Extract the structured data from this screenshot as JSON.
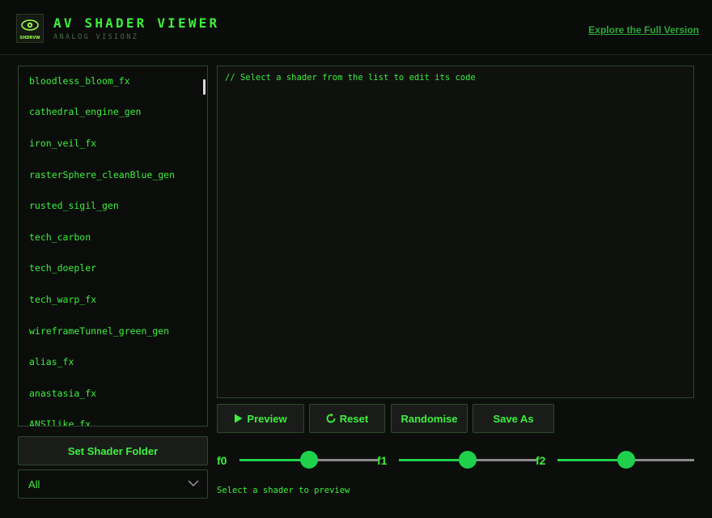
{
  "header": {
    "logo_text": "SHDRVW",
    "title": "AV SHADER VIEWER",
    "subtitle": "ANALOG VISIONZ",
    "explore_link": "Explore the Full Version"
  },
  "shader_list": {
    "items": [
      "bloodless_bloom_fx",
      "cathedral_engine_gen",
      "iron_veil_fx",
      "rasterSphere_cleanBlue_gen",
      "rusted_sigil_gen",
      "tech_carbon",
      "tech_doepler",
      "tech_warp_fx",
      "wireframeTunnel_green_gen",
      "alias_fx",
      "anastasia_fx",
      "ANSIlike_fx"
    ]
  },
  "editor": {
    "placeholder": "// Select a shader from the list to edit its code"
  },
  "toolbar": {
    "preview_label": "Preview",
    "reset_label": "Reset",
    "randomise_label": "Randomise",
    "save_as_label": "Save As"
  },
  "sidebar_controls": {
    "folder_button": "Set Shader Folder",
    "filter_value": "All"
  },
  "sliders": [
    {
      "label": "f0",
      "value": 0.5
    },
    {
      "label": "f1",
      "value": 0.5
    },
    {
      "label": "f2",
      "value": 0.5
    }
  ],
  "status": "Select a shader to preview",
  "colors": {
    "accent": "#3cf03c",
    "knob": "#1fd04a",
    "background": "#0c0e0c",
    "border": "#2b4a2b"
  }
}
